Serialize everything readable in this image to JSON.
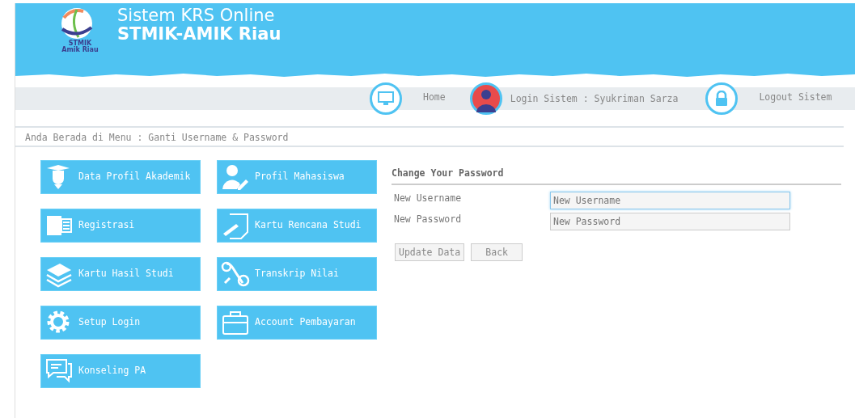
{
  "header": {
    "title": "Sistem KRS Online",
    "subtitle": "STMIK-AMIK Riau",
    "logo_text": [
      "STMIK",
      "Amik Riau"
    ]
  },
  "nav": [
    {
      "kind": "home",
      "label": "Home"
    },
    {
      "kind": "user",
      "label": "Login Sistem : Syukriman Sarza"
    },
    {
      "kind": "logout",
      "label": "Logout Sistem"
    }
  ],
  "breadcrumb": "Anda Berada di Menu : Ganti Username & Password",
  "menu": [
    {
      "kind": "graduate",
      "label": "Data Profil Akademik"
    },
    {
      "kind": "usered",
      "label": "Profil Mahasiswa"
    },
    {
      "kind": "document",
      "label": "Registrasi"
    },
    {
      "kind": "notepen",
      "label": "Kartu Rencana Studi"
    },
    {
      "kind": "stack",
      "label": "Kartu Hasil Studi"
    },
    {
      "kind": "scroll",
      "label": "Transkrip Nilai"
    },
    {
      "kind": "gear",
      "label": "Setup Login"
    },
    {
      "kind": "briefcase",
      "label": "Account Pembayaran"
    },
    {
      "kind": "chat",
      "label": "Konseling PA"
    }
  ],
  "form": {
    "title": "Change Your Password",
    "fields": [
      {
        "label": "New Username",
        "placeholder": "New Username",
        "focused": true
      },
      {
        "label": "New Password",
        "placeholder": "New Password",
        "focused": false
      }
    ],
    "buttons": [
      "Update Data",
      "Back"
    ]
  }
}
